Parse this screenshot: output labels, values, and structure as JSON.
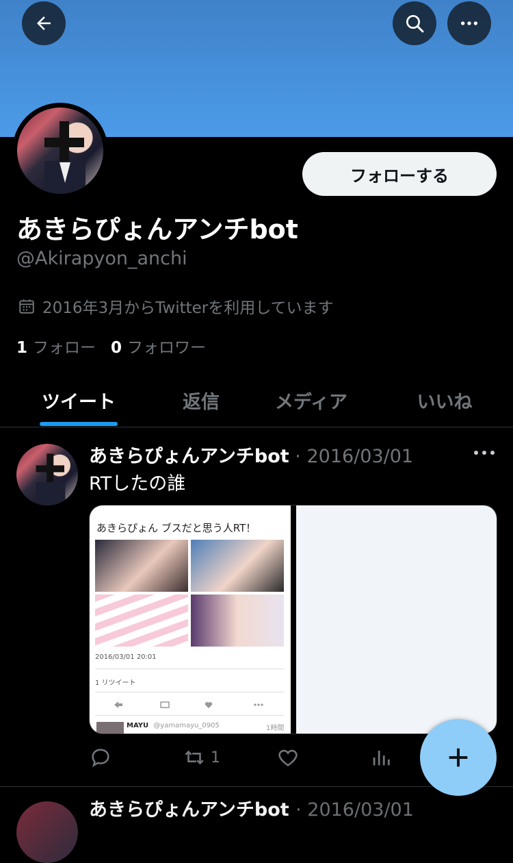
{
  "profile": {
    "display_name": "あきらぴょんアンチbot",
    "handle": "@Akirapyon_anchi",
    "joined": "2016年3月からTwitterを利用しています",
    "following_count": "1",
    "following_label": "フォロー",
    "followers_count": "0",
    "followers_label": "フォロワー",
    "follow_button": "フォローする"
  },
  "tabs": [
    "ツイート",
    "返信",
    "メディア",
    "いいね"
  ],
  "tweet": {
    "author": "あきらぴょんアンチbot",
    "date": "· 2016/03/01",
    "text": "RTしたの誰",
    "retweet_count": "1",
    "embedded": {
      "title": "あきらぴょん ブスだと思う人RT！",
      "timestamp": "2016/03/01 20:01",
      "retweets": "1 リツイート",
      "reply_user": "MAYU",
      "reply_handle": "@yamamayu_0905",
      "reply_time": "1時間"
    }
  },
  "next_tweet": {
    "author": "あきらぴょんアンチbot",
    "date": "· 2016/03/01"
  },
  "colors": {
    "banner": "#4c9be8",
    "accent": "#1d9bf0",
    "fab": "#8ecdf7"
  }
}
